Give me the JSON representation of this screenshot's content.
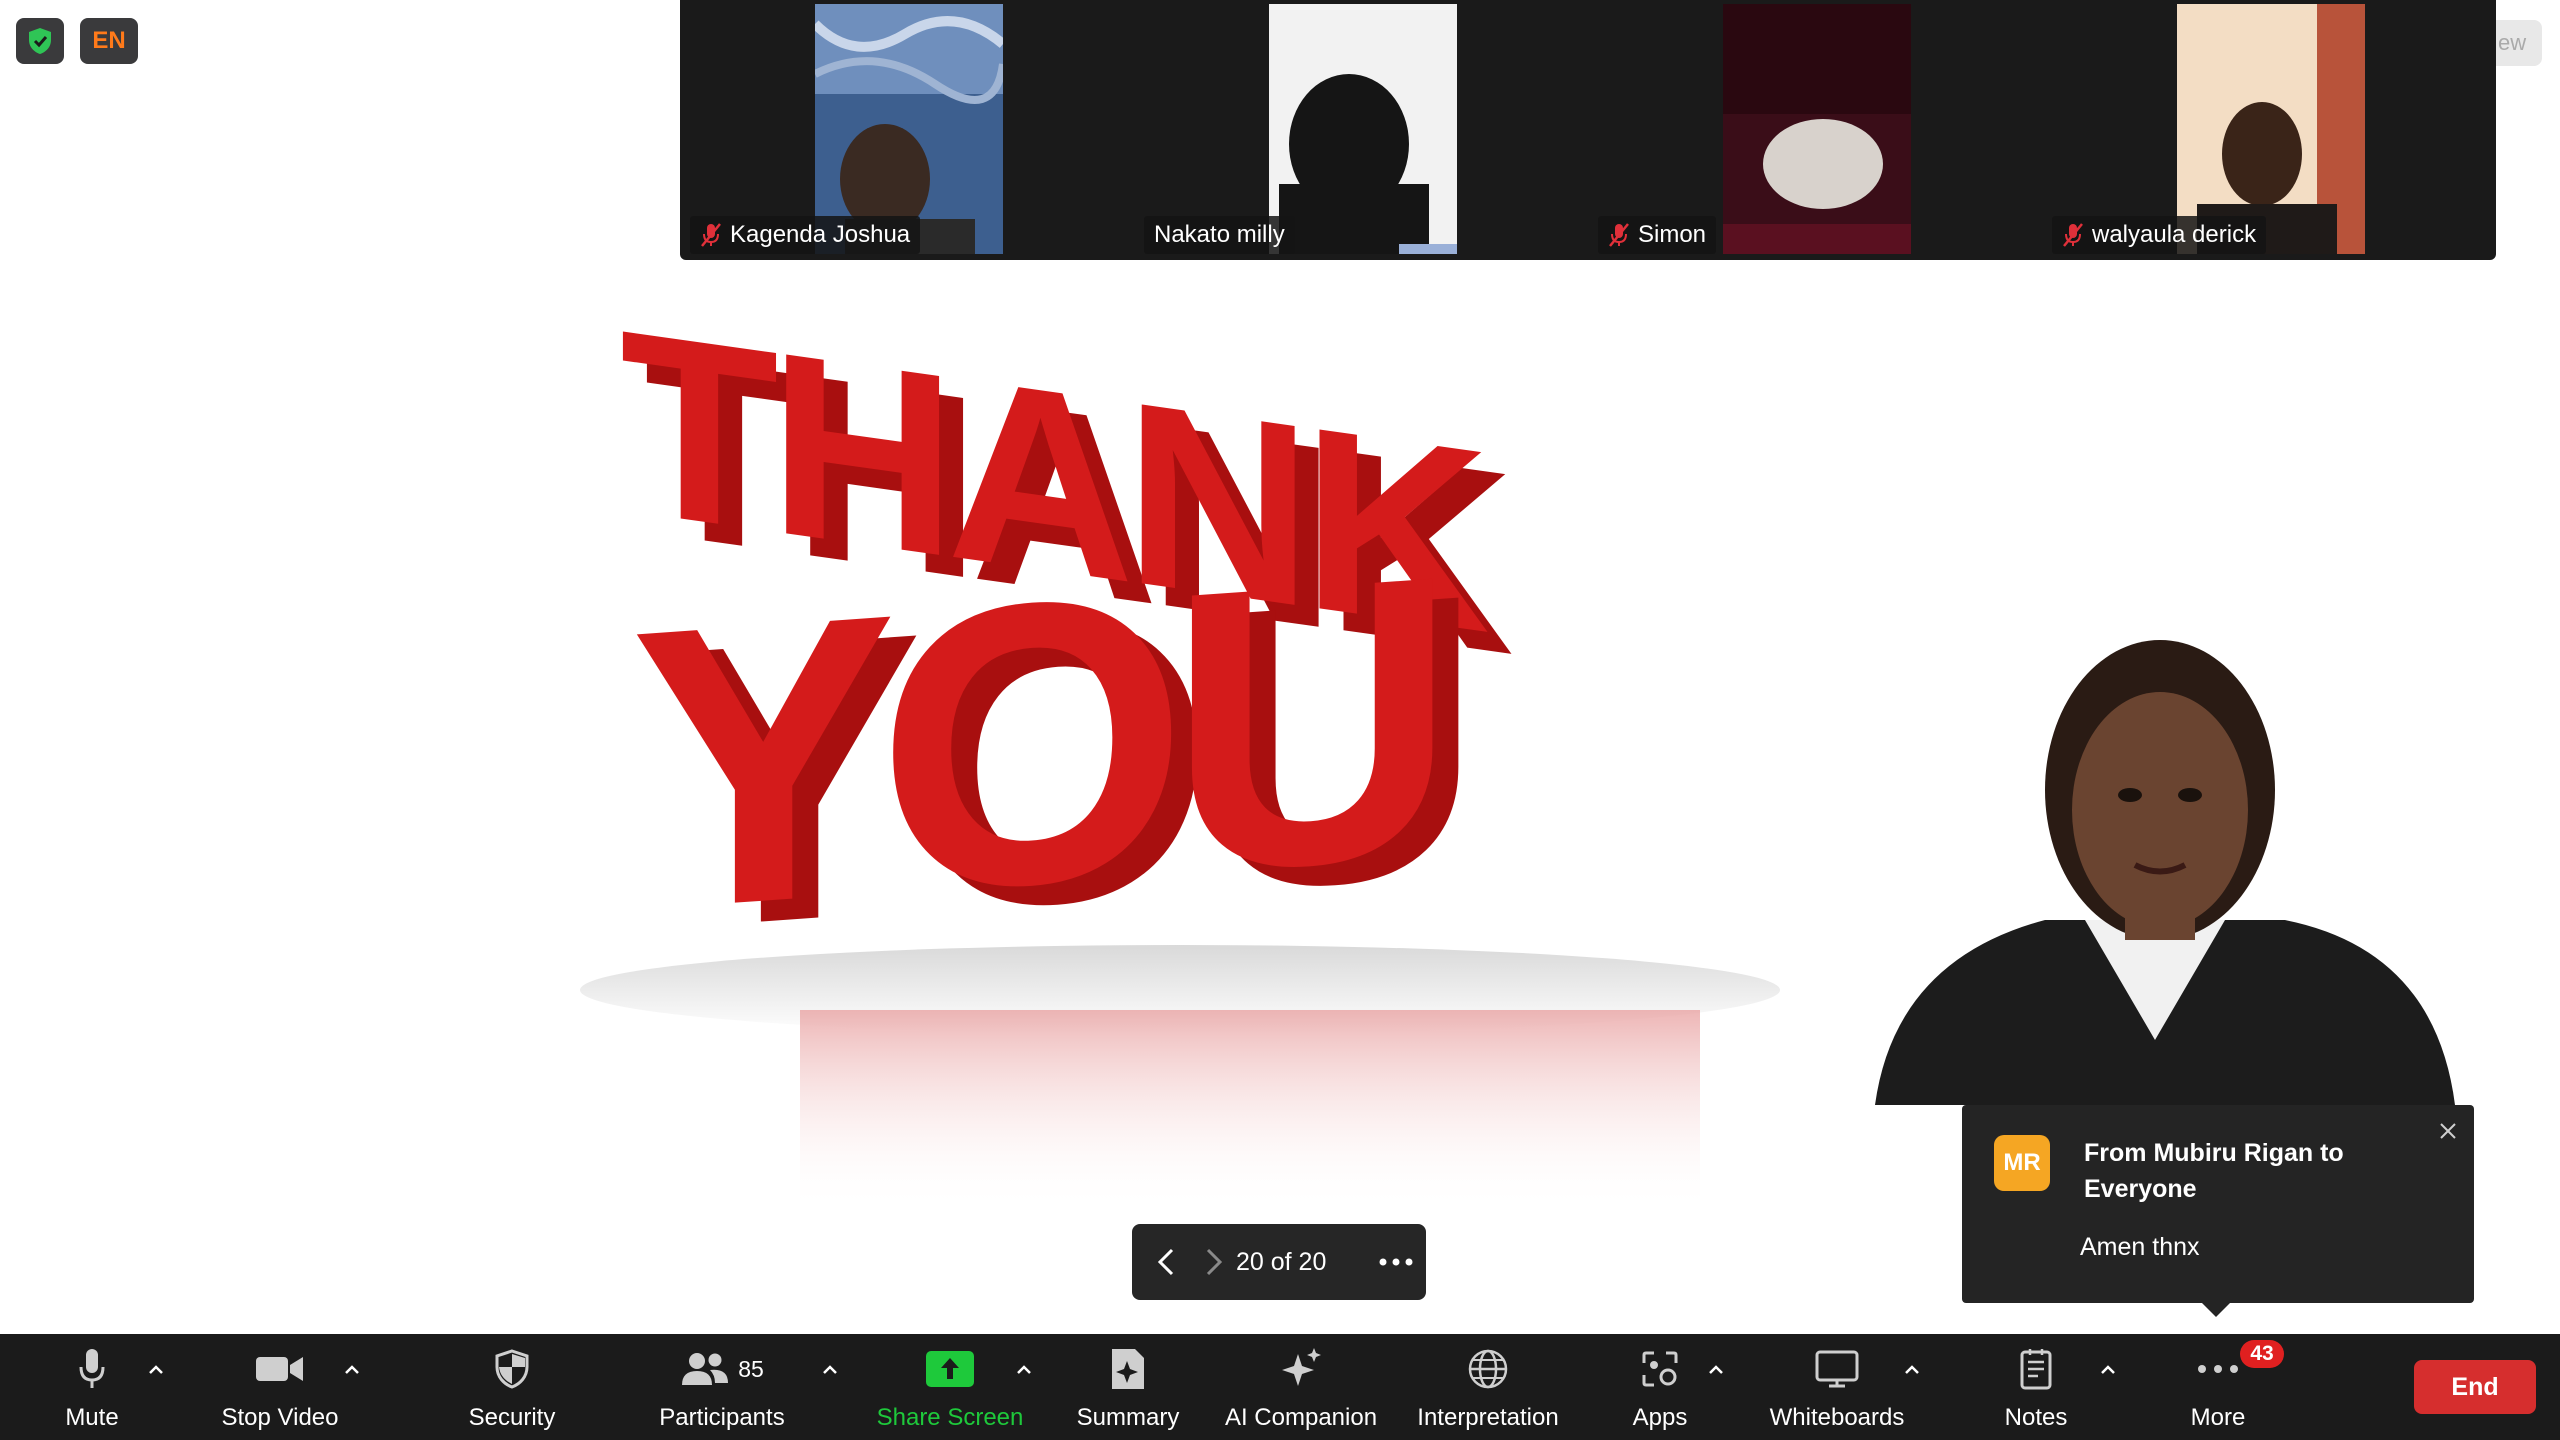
{
  "top_badges": {
    "language": "EN"
  },
  "participants_strip": [
    {
      "name": "Kagenda Joshua",
      "muted": true
    },
    {
      "name": "Nakato milly",
      "muted": false
    },
    {
      "name": "Simon",
      "muted": true
    },
    {
      "name": "walyaula derick",
      "muted": true
    }
  ],
  "view_tab": {
    "label": "ew"
  },
  "slide": {
    "page_counter": "20 of 20"
  },
  "chat_toast": {
    "avatar_initials": "MR",
    "from": "From Mubiru Rigan to Everyone",
    "message": "Amen thnx"
  },
  "toolbar": {
    "mute": "Mute",
    "stop_video": "Stop Video",
    "security": "Security",
    "participants": "Participants",
    "participants_count": "85",
    "share_screen": "Share Screen",
    "summary": "Summary",
    "ai_companion": "AI Companion",
    "interpretation": "Interpretation",
    "apps": "Apps",
    "whiteboards": "Whiteboards",
    "notes": "Notes",
    "more": "More",
    "more_badge": "43",
    "end": "End"
  },
  "colors": {
    "toolbar_bg": "#1b1b1b",
    "end_red": "#d62e2e",
    "share_green": "#1ec93b",
    "badge_red": "#e02020",
    "avatar_orange": "#f5a623",
    "slide_red": "#d41b1b"
  }
}
